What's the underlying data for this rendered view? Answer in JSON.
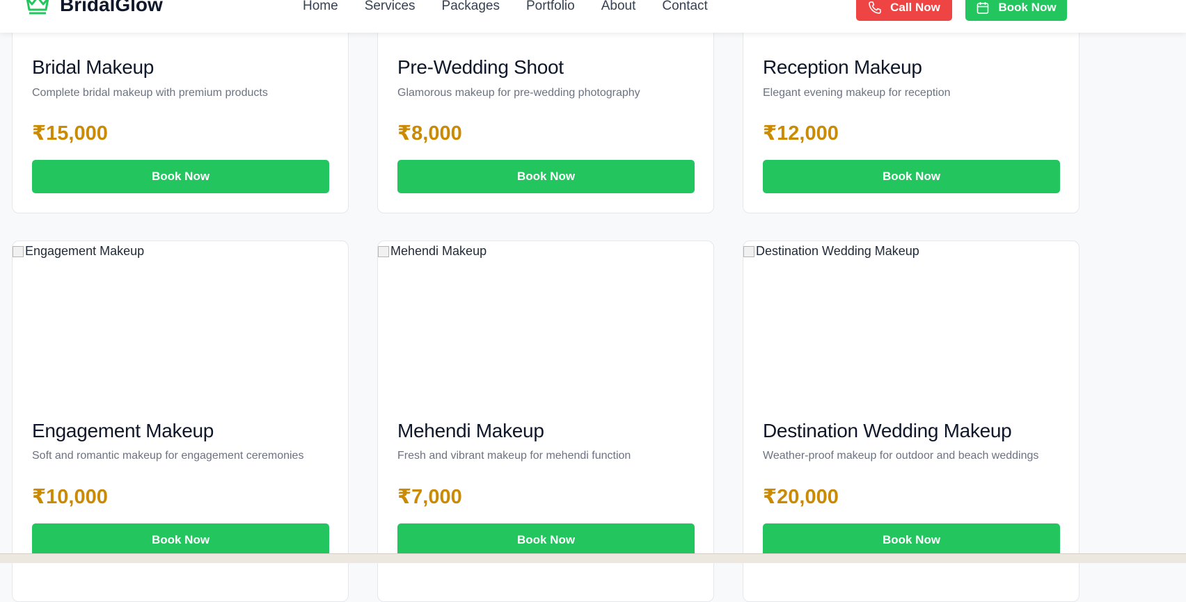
{
  "brand": {
    "name": "BridalGlow",
    "icon": "crown-icon",
    "color": "#22c55e"
  },
  "nav": {
    "links": [
      "Home",
      "Services",
      "Packages",
      "Portfolio",
      "About",
      "Contact"
    ],
    "call_label": "Call Now",
    "book_label": "Book Now"
  },
  "colors": {
    "call": "#ef4444",
    "book": "#22c55e",
    "price": "#ca8a04"
  },
  "services": [
    {
      "title": "Bridal Makeup",
      "desc": "Complete bridal makeup with premium products",
      "price": "₹15,000",
      "button": "Book Now"
    },
    {
      "title": "Pre-Wedding Shoot",
      "desc": "Glamorous makeup for pre-wedding photography",
      "price": "₹8,000",
      "button": "Book Now"
    },
    {
      "title": "Reception Makeup",
      "desc": "Elegant evening makeup for reception",
      "price": "₹12,000",
      "button": "Book Now"
    },
    {
      "title": "Engagement Makeup",
      "img_alt": "Engagement Makeup",
      "desc": "Soft and romantic makeup for engagement ceremonies",
      "price": "₹10,000",
      "button": "Book Now"
    },
    {
      "title": "Mehendi Makeup",
      "img_alt": "Mehendi Makeup",
      "desc": "Fresh and vibrant makeup for mehendi function",
      "price": "₹7,000",
      "button": "Book Now"
    },
    {
      "title": "Destination Wedding Makeup",
      "img_alt": "Destination Wedding Makeup",
      "desc": "Weather-proof makeup for outdoor and beach weddings",
      "price": "₹20,000",
      "button": "Book Now"
    }
  ]
}
